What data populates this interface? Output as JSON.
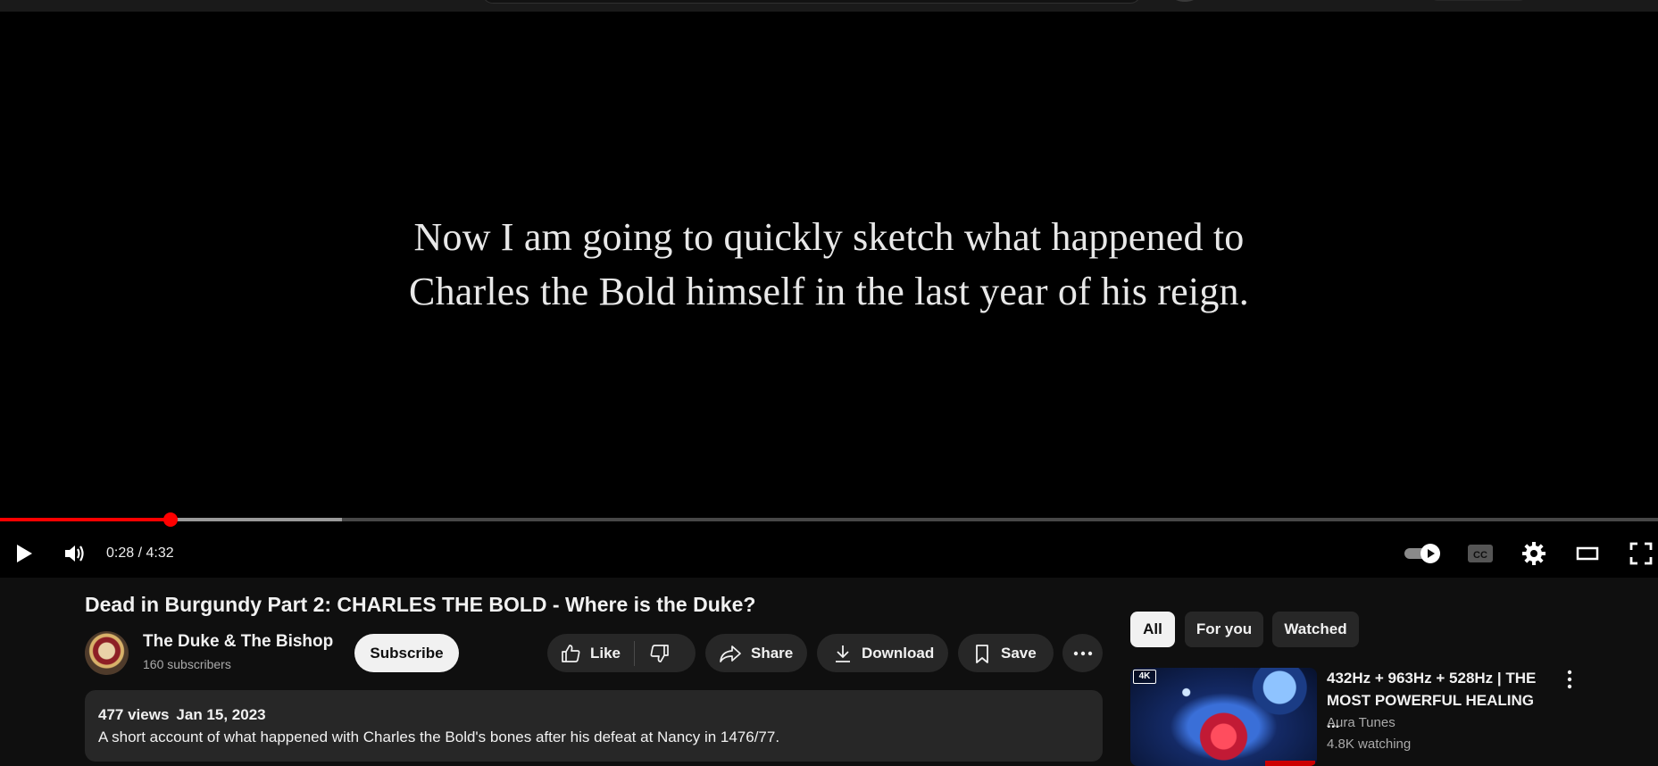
{
  "video": {
    "caption_lines": [
      "Now I am going to quickly sketch what happened to",
      "Charles the Bold himself in the last year of his reign."
    ],
    "time_current": "0:28",
    "time_total": "4:32",
    "time_display": "0:28 / 4:32",
    "played_fraction": 0.103,
    "buffered_fraction": 0.206,
    "progress_color": "#ff0000"
  },
  "title": "Dead in Burgundy Part 2: CHARLES THE BOLD - Where is the Duke?",
  "channel": {
    "name": "The Duke & The Bishop",
    "subscribers": "160 subscribers",
    "subscribe_label": "Subscribe"
  },
  "actions": {
    "like": "Like",
    "share": "Share",
    "download": "Download",
    "save": "Save"
  },
  "description": {
    "views": "477 views",
    "date": "Jan 15, 2023",
    "text": "A short account of what happened with Charles the Bold's bones after his defeat at Nancy in 1476/77."
  },
  "chips": [
    "All",
    "For you",
    "Watched"
  ],
  "recommendation": {
    "badge": "4K",
    "title": "432Hz + 963Hz + 528Hz | THE MOST POWERFUL HEALING ...",
    "channel": "Aura Tunes",
    "watching": "4.8K watching"
  },
  "icons": {
    "play": "play-icon",
    "volume": "volume-icon",
    "autoplay": "autoplay-toggle-icon",
    "captions": "cc-icon",
    "settings": "gear-icon",
    "theater": "theater-mode-icon",
    "fullscreen": "fullscreen-icon",
    "like": "thumbs-up-icon",
    "dislike": "thumbs-down-icon",
    "share": "share-arrow-icon",
    "download": "download-icon",
    "save": "bookmark-icon",
    "more": "more-horizontal-icon",
    "rec_menu": "more-vertical-icon"
  }
}
